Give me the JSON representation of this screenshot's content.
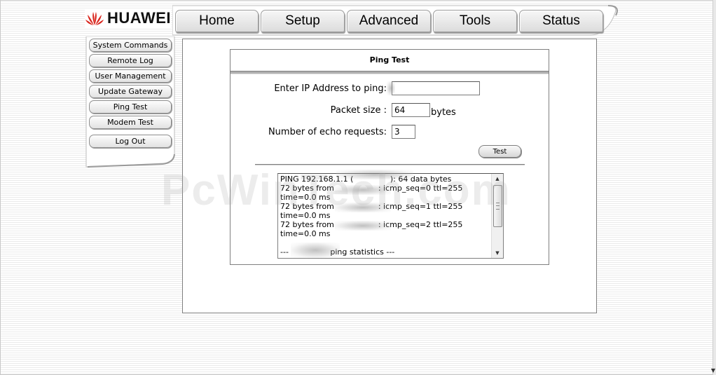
{
  "brand": {
    "name": "HUAWEI",
    "logo_icon": "huawei-petal-icon",
    "logo_color": "#d9251d"
  },
  "nav": {
    "tabs": [
      {
        "label": "Home"
      },
      {
        "label": "Setup"
      },
      {
        "label": "Advanced"
      },
      {
        "label": "Tools",
        "active": true
      },
      {
        "label": "Status"
      }
    ]
  },
  "sidebar": {
    "items": [
      {
        "label": "System Commands"
      },
      {
        "label": "Remote Log"
      },
      {
        "label": "User Management"
      },
      {
        "label": "Update Gateway"
      },
      {
        "label": "Ping Test",
        "active": true
      },
      {
        "label": "Modem Test"
      },
      {
        "label": "Log Out"
      }
    ]
  },
  "ping_test": {
    "title": "Ping Test",
    "ip_label": "Enter IP Address to ping:",
    "ip_value": "",
    "packet_label": "Packet size :",
    "packet_value": "64",
    "packet_unit": "bytes",
    "echo_label": "Number of echo requests:",
    "echo_value": "3",
    "test_button": "Test",
    "output": "PING 192.168.1.1 (               ): 64 data bytes\n72 bytes from                  : icmp_seq=0 ttl=255\ntime=0.0 ms\n72 bytes from                  : icmp_seq=1 ttl=255\ntime=0.0 ms\n72 bytes from                  : icmp_seq=2 ttl=255\ntime=0.0 ms\n\n---                 ping statistics ---"
  },
  "watermark": {
    "text": "PcWinTech.com"
  },
  "colors": {
    "accent": "#d9251d",
    "panel_border": "#7f7f7f",
    "button_face": "#e6e6e6"
  }
}
